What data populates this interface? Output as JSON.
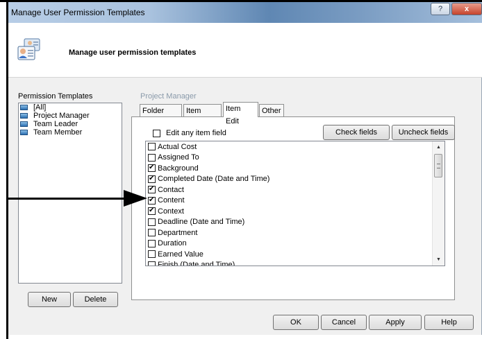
{
  "window": {
    "title": "Manage User Permission Templates",
    "help_glyph": "?",
    "close_glyph": "x"
  },
  "header": {
    "title": "Manage user permission templates",
    "icon": "users-icon"
  },
  "templates": {
    "label": "Permission Templates",
    "items": [
      {
        "label": "[All]",
        "icon": "template-icon"
      },
      {
        "label": "Project Manager",
        "icon": "template-icon"
      },
      {
        "label": "Team Leader",
        "icon": "template-icon"
      },
      {
        "label": "Team Member",
        "icon": "template-icon"
      }
    ],
    "new_label": "New",
    "delete_label": "Delete"
  },
  "detail": {
    "selected_template": "Project Manager",
    "tabs": [
      "Folder View",
      "Item View",
      "Item Edit",
      "Other"
    ],
    "active_tab": "Item Edit",
    "edit_any_label": "Edit any item field",
    "edit_any_checked": false,
    "check_fields_label": "Check fields",
    "uncheck_fields_label": "Uncheck fields",
    "fields": [
      {
        "label": "Actual Cost",
        "checked": false
      },
      {
        "label": "Assigned To",
        "checked": false
      },
      {
        "label": "Background",
        "checked": true
      },
      {
        "label": "Completed Date (Date and Time)",
        "checked": true
      },
      {
        "label": "Contact",
        "checked": true
      },
      {
        "label": "Content",
        "checked": true
      },
      {
        "label": "Context",
        "checked": true
      },
      {
        "label": "Deadline (Date and Time)",
        "checked": false
      },
      {
        "label": "Department",
        "checked": false
      },
      {
        "label": "Duration",
        "checked": false
      },
      {
        "label": "Earned Value",
        "checked": false
      },
      {
        "label": "Finish (Date and Time)",
        "checked": false
      }
    ]
  },
  "footer": {
    "ok": "OK",
    "cancel": "Cancel",
    "apply": "Apply",
    "help": "Help"
  },
  "colors": {
    "section_label_grey": "#8a9aaa",
    "title_gradient_mid": "#5f87b3"
  }
}
